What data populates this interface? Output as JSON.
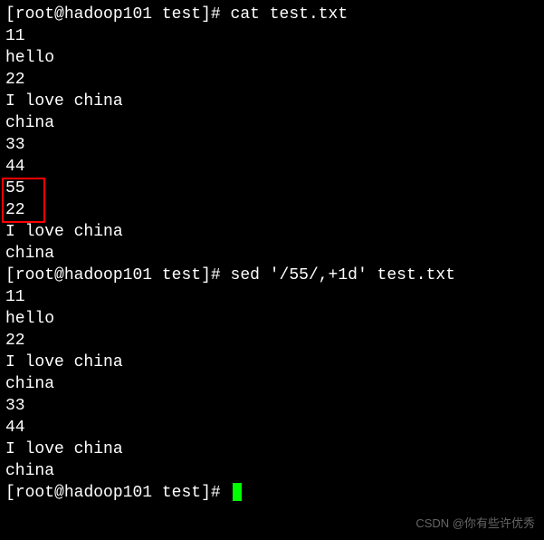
{
  "prompt1": {
    "user": "root",
    "host": "hadoop101",
    "dir": "test",
    "symbol": "#",
    "command": "cat test.txt"
  },
  "output1": [
    "11",
    "hello",
    "22",
    "I love china",
    "china",
    "33",
    "44",
    "55",
    "22",
    "I love china",
    "china"
  ],
  "prompt2": {
    "user": "root",
    "host": "hadoop101",
    "dir": "test",
    "symbol": "#",
    "command": "sed '/55/,+1d' test.txt"
  },
  "output2": [
    "11",
    "hello",
    "22",
    "I love china",
    "china",
    "33",
    "44",
    "I love china",
    "china"
  ],
  "prompt3": {
    "user": "root",
    "host": "hadoop101",
    "dir": "test",
    "symbol": "#",
    "command": ""
  },
  "watermark": "CSDN @你有些许优秀"
}
